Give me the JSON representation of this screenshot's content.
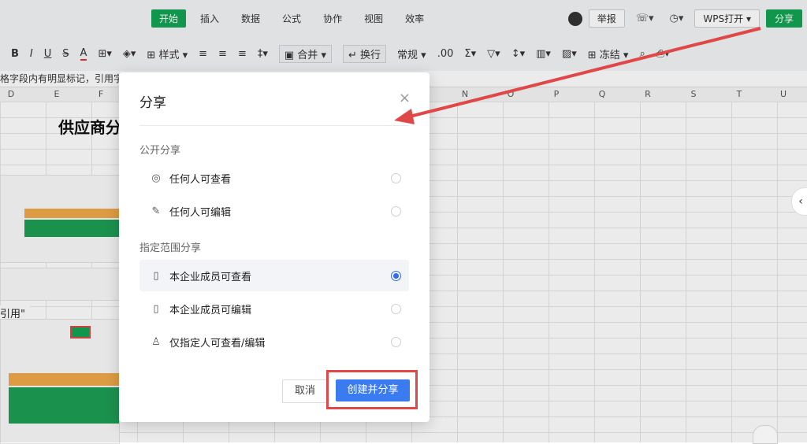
{
  "menu": {
    "tabs": [
      "开始",
      "插入",
      "数据",
      "公式",
      "协作",
      "视图",
      "效率"
    ],
    "report_label": "举报",
    "wps_open_label": "WPS打开",
    "share_label": "分享"
  },
  "toolbar": {
    "bold": "B",
    "italic": "I",
    "underline": "U",
    "strike": "S",
    "font_color": "A",
    "style_label": "样式",
    "merge_label": "合并",
    "wrap_label": "换行",
    "format_label": "常规",
    "freeze_label": "冻结"
  },
  "formula_hint": "格字段内有明显标记，引用字段不",
  "columns": [
    "D",
    "E",
    "F",
    "N",
    "O",
    "P",
    "Q",
    "R",
    "S",
    "T",
    "U"
  ],
  "sheet": {
    "title": "供应商分",
    "ref_text": "引用\""
  },
  "dialog": {
    "title": "分享",
    "close_icon": "×",
    "public_section": "公开分享",
    "public_options": [
      {
        "label": "任何人可查看",
        "icon": "eye-icon",
        "selected": false
      },
      {
        "label": "任何人可编辑",
        "icon": "pencil-icon",
        "selected": false
      }
    ],
    "scoped_section": "指定范围分享",
    "scoped_options": [
      {
        "label": "本企业成员可查看",
        "icon": "building-icon",
        "selected": true
      },
      {
        "label": "本企业成员可编辑",
        "icon": "building-icon",
        "selected": false
      },
      {
        "label": "仅指定人可查看/编辑",
        "icon": "person-icon",
        "selected": false
      }
    ],
    "cancel_label": "取消",
    "create_label": "创建并分享"
  },
  "colors": {
    "brand_green": "#12a354",
    "primary_blue": "#3b7bf2",
    "annotation_red": "#e04848"
  }
}
